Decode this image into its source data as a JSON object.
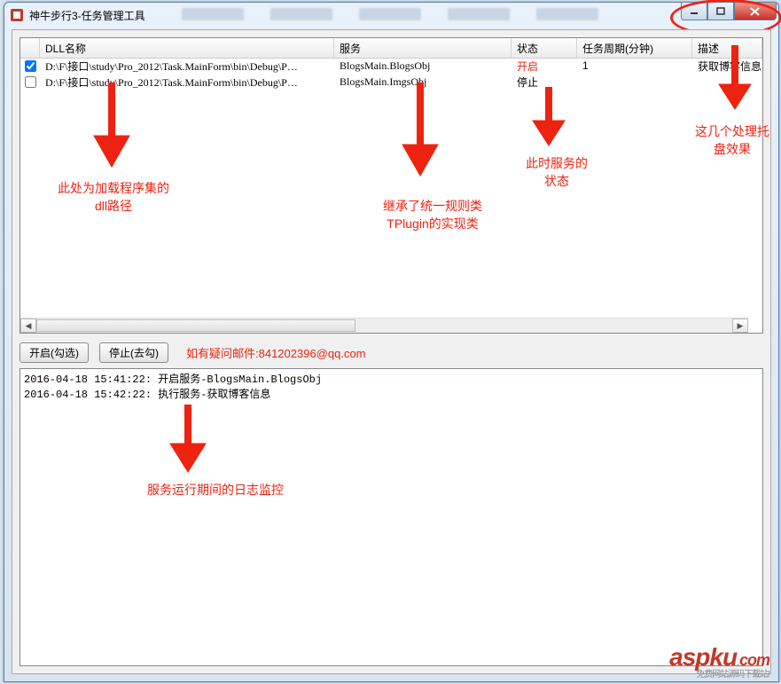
{
  "window": {
    "title": "神牛步行3-任务管理工具"
  },
  "columns": {
    "dll": "DLL名称",
    "service": "服务",
    "state": "状态",
    "period": "任务周期(分钟)",
    "desc": "描述"
  },
  "rows": [
    {
      "checked": true,
      "dll": "D:\\F\\接口\\study\\Pro_2012\\Task.MainForm\\bin\\Debug\\P…",
      "service": "BlogsMain.BlogsObj",
      "state": "开启",
      "state_on": true,
      "period": "1",
      "desc": "获取博客信息"
    },
    {
      "checked": false,
      "dll": "D:\\F\\接口\\study\\Pro_2012\\Task.MainForm\\bin\\Debug\\P…",
      "service": "BlogsMain.ImgsObj",
      "state": "停止",
      "state_on": false,
      "period": "",
      "desc": ""
    }
  ],
  "toolbar": {
    "start": "开启(勾选)",
    "stop": "停止(去勾)",
    "note": "如有疑问邮件:841202396@qq.com"
  },
  "log": "2016-04-18 15:41:22: 开启服务-BlogsMain.BlogsObj\n2016-04-18 15:42:22: 执行服务-获取博客信息",
  "annotations": {
    "dll_hint1": "此处为加载程序集的",
    "dll_hint2": "dll路径",
    "svc_hint1": "继承了统一规则类",
    "svc_hint2": "TPlugin的实现类",
    "state_hint1": "此时服务的",
    "state_hint2": "状态",
    "tray_hint1": "这几个处理托",
    "tray_hint2": "盘效果",
    "log_hint": "服务运行期间的日志监控"
  },
  "watermark": {
    "brand": "aspku",
    "tld": "com",
    "sub": "免费网站源码下载站!"
  }
}
